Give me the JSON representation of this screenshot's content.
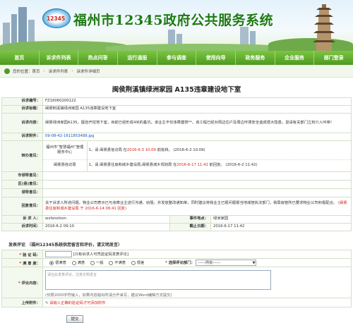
{
  "header": {
    "logo_text": "12345",
    "title": "福州市12345政府公共服务系统"
  },
  "nav": {
    "items": [
      "首页",
      "诉求件列表",
      "热点问答",
      "运行通报",
      "参与调查",
      "使用向导",
      "政务服务",
      "企业服务",
      "部门登录"
    ]
  },
  "breadcrumb": {
    "prefix": "您的位置：",
    "items": [
      "首页",
      "诉求件列表",
      "诉求件详细页"
    ]
  },
  "detail": {
    "title": "闽侯荆溪镇绿洲家园 A135违章建设地下室",
    "fields": {
      "id_label": "诉求编号：",
      "id_value": "FZ16060200122",
      "subject_label": "诉求标题：",
      "subject_value": "闽侯荆溪镇绿洲家园 A135违章建设地下室",
      "content_label": "诉求内容：",
      "content_value": "闽侯绿洲家园A135，擅自开挖地下室，目前已经形成4米的基坑，该业主不仅违章建筑**，该工程已经对周边住户及周边环境安全造成很大隐患，恳请有关部门立刻介入叫停！",
      "attach_label": "诉求附件：",
      "attach_value": "09-08-42-1611853488.jpg",
      "proc_label": "转办意见：",
      "proc_rows": [
        {
          "dept": "福州市“智慧福州”管理服务中心",
          "text": "1、请 闽侯县信访局 在2016-6-3 10:09 前批转。 (2016-6-2 10:09)"
        },
        {
          "dept": "闽侯县信访局",
          "text": "1、请 闽侯县住房和城乡建设局,闽侯县城乡规划局 在2016-6-17 11:42 前回复。 (2016-6-2 11:42)"
        }
      ],
      "city_label": "市领导意见：",
      "district_label": "区(县)意见：",
      "leader_label": "领导意见：",
      "reply_label": "回复意见：",
      "reply_text": "关于诉求人所述问题，物业公司表示已与违章业主进行沟通、劝阻，并发放整改通知单，同时建议将我业主已报问题报当地城管执法部门，我局房管所已要求物业公司积极配合。",
      "reply_sign": "(闽侯县住房和城乡建设局 于 2016-6-14 08:41 回复)",
      "person_label": "诉 求 人：",
      "person_value": "wxfsnetism",
      "event_label": "事件地点：",
      "event_value": "绿洲家园",
      "time_label": "诉求时间：",
      "time_value": "2016-6-2 09:10",
      "deadline_label": "截止日期：",
      "deadline_value": "2016-6-17 11:42"
    }
  },
  "comment": {
    "section": "发表评论 （福州12345系统供您留言和评价，请文明发言）",
    "captcha_label": "验 证 码：",
    "captcha_hint": "[只有诉求人可凭验证码发表评论]",
    "satisfaction_label": "满 意 度：",
    "options": [
      "很满意",
      "满意",
      "一般",
      "不满意",
      "很差"
    ],
    "dept_label": "选择评论部门：",
    "dept_value": "------所有------",
    "content_label": "评论内容：",
    "content_placeholder": "请在此发表评论，注意文明发言",
    "content_hint": "(仅限2000字符输入，如果内容超出时请分开来写，建议Word编辑方式提交)",
    "upload_label": "上传附件：",
    "upload_hint": "请输入正确的验证码才可添加附件",
    "submit_label": "提交"
  }
}
